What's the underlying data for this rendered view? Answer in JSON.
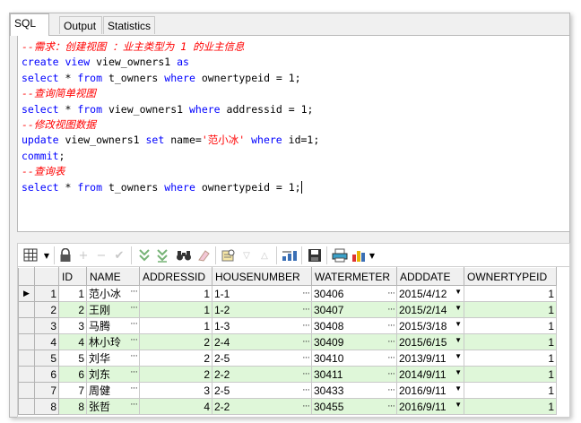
{
  "tabs": [
    {
      "label": "SQL",
      "active": true
    },
    {
      "label": "Output",
      "active": false
    },
    {
      "label": "Statistics",
      "active": false
    }
  ],
  "editor": {
    "lines": [
      [
        {
          "t": "--需求：创建视图 ：业主类型为 1 的业主信息",
          "c": "cm"
        }
      ],
      [
        {
          "t": "create",
          "c": "kw"
        },
        {
          "t": " ",
          "c": "tx"
        },
        {
          "t": "view",
          "c": "kw"
        },
        {
          "t": " view_owners1 ",
          "c": "tx"
        },
        {
          "t": "as",
          "c": "kw"
        }
      ],
      [
        {
          "t": "select",
          "c": "kw"
        },
        {
          "t": " * ",
          "c": "tx"
        },
        {
          "t": "from",
          "c": "kw"
        },
        {
          "t": " t_owners ",
          "c": "tx"
        },
        {
          "t": "where",
          "c": "kw"
        },
        {
          "t": " ownertypeid = 1;",
          "c": "tx"
        }
      ],
      [
        {
          "t": "--查询简单视图",
          "c": "cm"
        }
      ],
      [
        {
          "t": "select",
          "c": "kw"
        },
        {
          "t": " * ",
          "c": "tx"
        },
        {
          "t": "from",
          "c": "kw"
        },
        {
          "t": " view_owners1 ",
          "c": "tx"
        },
        {
          "t": "where",
          "c": "kw"
        },
        {
          "t": " addressid = 1;",
          "c": "tx"
        }
      ],
      [
        {
          "t": "--修改视图数据",
          "c": "cm"
        }
      ],
      [
        {
          "t": "update",
          "c": "kw"
        },
        {
          "t": " view_owners1 ",
          "c": "tx"
        },
        {
          "t": "set",
          "c": "kw"
        },
        {
          "t": " name=",
          "c": "tx"
        },
        {
          "t": "'范小冰'",
          "c": "st"
        },
        {
          "t": " ",
          "c": "tx"
        },
        {
          "t": "where",
          "c": "kw"
        },
        {
          "t": " id=1;",
          "c": "tx"
        }
      ],
      [
        {
          "t": "commit",
          "c": "kw"
        },
        {
          "t": ";",
          "c": "tx"
        }
      ],
      [
        {
          "t": "--查询表",
          "c": "cm"
        }
      ],
      [
        {
          "t": "select",
          "c": "kw"
        },
        {
          "t": " * ",
          "c": "tx"
        },
        {
          "t": "from",
          "c": "kw"
        },
        {
          "t": " t_owners ",
          "c": "tx"
        },
        {
          "t": "where",
          "c": "kw"
        },
        {
          "t": " ownertypeid = 1;",
          "c": "tx"
        }
      ]
    ]
  },
  "grid": {
    "columns": [
      "ID",
      "NAME",
      "ADDRESSID",
      "HOUSENUMBER",
      "WATERMETER",
      "ADDDATE",
      "OWNERTYPEID"
    ],
    "rows": [
      {
        "rownum": "1",
        "id": "1",
        "name": "范小冰",
        "addressid": "1",
        "housenumber": "1-1",
        "watermeter": "30406",
        "adddate": "2015/4/12",
        "ownertypeid": "1"
      },
      {
        "rownum": "2",
        "id": "2",
        "name": "王刚",
        "addressid": "1",
        "housenumber": "1-2",
        "watermeter": "30407",
        "adddate": "2015/2/14",
        "ownertypeid": "1"
      },
      {
        "rownum": "3",
        "id": "3",
        "name": "马腾",
        "addressid": "1",
        "housenumber": "1-3",
        "watermeter": "30408",
        "adddate": "2015/3/18",
        "ownertypeid": "1"
      },
      {
        "rownum": "4",
        "id": "4",
        "name": "林小玲",
        "addressid": "2",
        "housenumber": "2-4",
        "watermeter": "30409",
        "adddate": "2015/6/15",
        "ownertypeid": "1"
      },
      {
        "rownum": "5",
        "id": "5",
        "name": "刘华",
        "addressid": "2",
        "housenumber": "2-5",
        "watermeter": "30410",
        "adddate": "2013/9/11",
        "ownertypeid": "1"
      },
      {
        "rownum": "6",
        "id": "6",
        "name": "刘东",
        "addressid": "2",
        "housenumber": "2-2",
        "watermeter": "30411",
        "adddate": "2014/9/11",
        "ownertypeid": "1"
      },
      {
        "rownum": "7",
        "id": "7",
        "name": "周健",
        "addressid": "3",
        "housenumber": "2-5",
        "watermeter": "30433",
        "adddate": "2016/9/11",
        "ownertypeid": "1"
      },
      {
        "rownum": "8",
        "id": "8",
        "name": "张哲",
        "addressid": "4",
        "housenumber": "2-2",
        "watermeter": "30455",
        "adddate": "2016/9/11",
        "ownertypeid": "1"
      }
    ]
  },
  "toolbar": {
    "icons": [
      "grid-select-icon",
      "lock-icon",
      "add-record-icon",
      "delete-record-icon",
      "post-changes-icon",
      "fetch-next-icon",
      "fetch-last-icon",
      "find-icon",
      "clear-icon",
      "query-by-example-icon",
      "sort-down-icon",
      "sort-up-icon",
      "export-icon",
      "save-icon",
      "print-icon",
      "chart-icon"
    ]
  },
  "colors": {
    "keyword": "#0000ff",
    "comment": "#ff0000",
    "even_row": "#dff7d9"
  }
}
